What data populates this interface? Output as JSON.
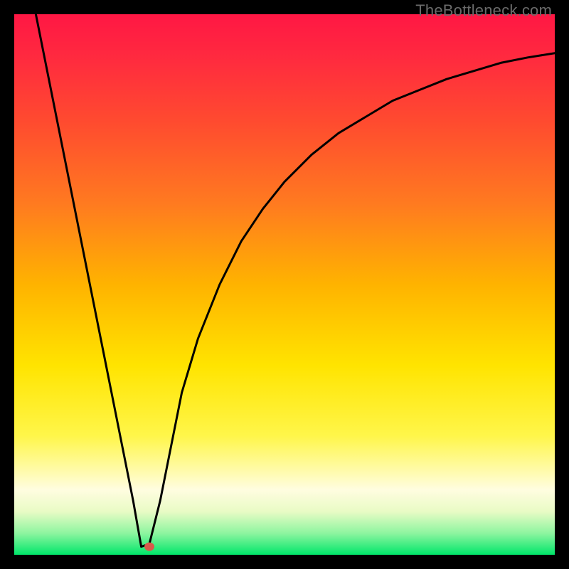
{
  "watermark": "TheBottleneck.com",
  "chart_data": {
    "type": "line",
    "title": "",
    "xlabel": "",
    "ylabel": "",
    "xlim": [
      0,
      100
    ],
    "ylim": [
      0,
      100
    ],
    "grid": false,
    "legend": false,
    "background_gradient_stops": [
      {
        "offset": 0.0,
        "color": "#ff1744"
      },
      {
        "offset": 0.08,
        "color": "#ff2a3f"
      },
      {
        "offset": 0.2,
        "color": "#ff4b2f"
      },
      {
        "offset": 0.35,
        "color": "#ff7a20"
      },
      {
        "offset": 0.5,
        "color": "#ffb300"
      },
      {
        "offset": 0.65,
        "color": "#ffe400"
      },
      {
        "offset": 0.78,
        "color": "#fff64a"
      },
      {
        "offset": 0.88,
        "color": "#fffde0"
      },
      {
        "offset": 0.92,
        "color": "#e9fbc5"
      },
      {
        "offset": 0.96,
        "color": "#8ef5a0"
      },
      {
        "offset": 1.0,
        "color": "#00e66a"
      }
    ],
    "series": [
      {
        "name": "bottleneck-curve",
        "color": "#000000",
        "x": [
          4,
          6,
          8,
          10,
          12,
          14,
          16,
          18,
          20,
          22,
          23.5,
          25,
          27,
          29,
          31,
          34,
          38,
          42,
          46,
          50,
          55,
          60,
          65,
          70,
          75,
          80,
          85,
          90,
          95,
          100
        ],
        "y": [
          100,
          90,
          80,
          70,
          60,
          50,
          40,
          30,
          20,
          10,
          1.5,
          2,
          10,
          20,
          30,
          40,
          50,
          58,
          64,
          69,
          74,
          78,
          81,
          84,
          86,
          88,
          89.5,
          91,
          92,
          92.8
        ]
      }
    ],
    "marker": {
      "name": "optimal-point",
      "x": 25,
      "y": 1.5,
      "color": "#d85a4a",
      "rx": 7,
      "ry": 6
    }
  }
}
